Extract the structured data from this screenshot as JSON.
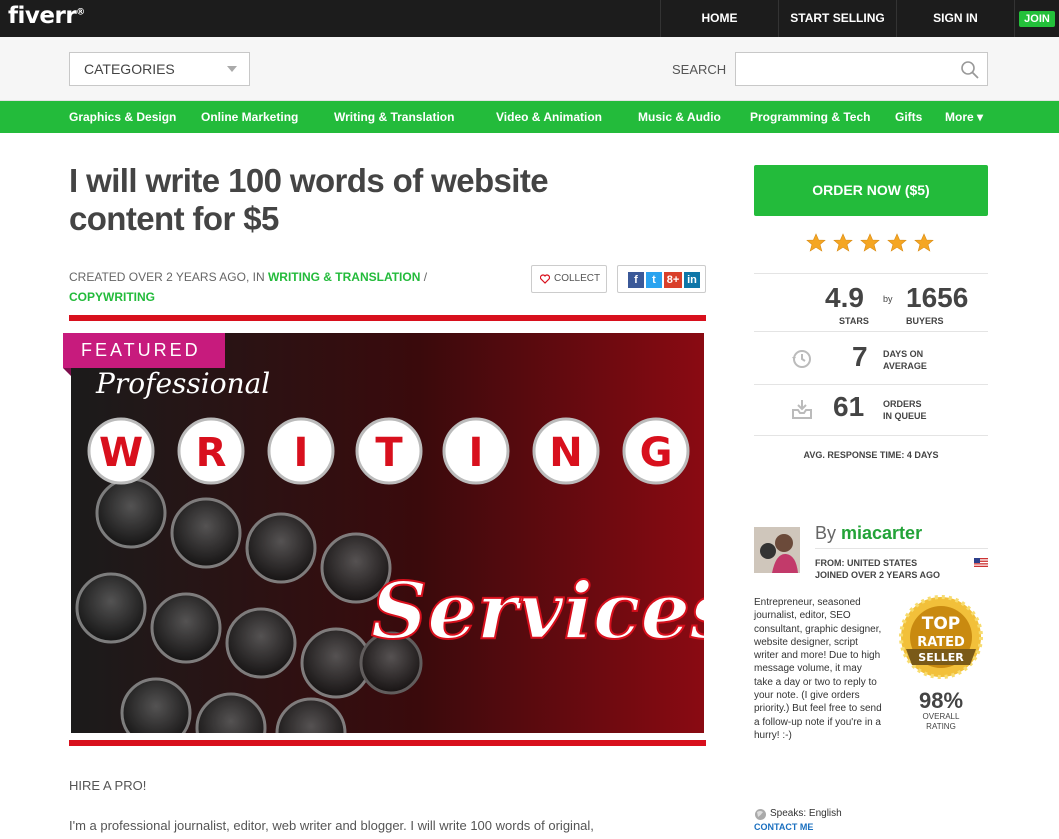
{
  "brand": {
    "logo": "fiverr",
    "mark": "®"
  },
  "topnav": {
    "home": "HOME",
    "start_selling": "START SELLING",
    "sign_in": "SIGN IN",
    "join": "JOIN"
  },
  "search": {
    "categories_label": "CATEGORIES",
    "label": "SEARCH",
    "placeholder": ""
  },
  "categories": [
    "Graphics & Design",
    "Online Marketing",
    "Writing & Translation",
    "Video & Animation",
    "Music & Audio",
    "Programming & Tech",
    "Gifts",
    "More ▾"
  ],
  "gig": {
    "title": "I will write 100 words of website content for $5",
    "created_prefix": "CREATED OVER 2 YEARS AGO, IN ",
    "category": "WRITING & TRANSLATION",
    "separator": " / ",
    "subcategory": "COPYWRITING",
    "collect": "COLLECT",
    "featured": "FEATURED",
    "hero_script_top": "Professional",
    "hero_letters": [
      "W",
      "R",
      "I",
      "T",
      "I",
      "N",
      "G"
    ],
    "hero_script_bottom": "Services"
  },
  "social": {
    "facebook": "f",
    "twitter": "t",
    "gplus": "8+",
    "linkedin": "in"
  },
  "sidebar": {
    "order_button": "ORDER NOW ($5)",
    "rating": "4.9",
    "stars_label": "STARS",
    "by": "by",
    "buyers": "1656",
    "buyers_label": "BUYERS",
    "days": "7",
    "days_label_1": "DAYS ON",
    "days_label_2": "AVERAGE",
    "orders": "61",
    "orders_label_1": "ORDERS",
    "orders_label_2": "IN QUEUE",
    "response": "AVG. RESPONSE TIME: 4 DAYS"
  },
  "seller": {
    "by_prefix": "By ",
    "username": "miacarter",
    "from": "FROM: UNITED STATES",
    "joined": "JOINED OVER 2 YEARS AGO",
    "bio": "Entrepreneur, seasoned journalist, editor, SEO consultant, graphic designer, website designer, script writer and more! Due to high message volume, it may take a day or two to reply to your note. (I give orders priority.) But feel free to send a follow-up note if you're in a hurry! :-)",
    "badge_top": "TOP",
    "badge_rated": "RATED",
    "badge_seller": "SELLER",
    "percent": "98%",
    "overall_1": "OVERALL",
    "overall_2": "RATING",
    "speaks": "Speaks: English",
    "contact": "CONTACT ME"
  },
  "description": {
    "heading": "HIRE A PRO!",
    "text": "I'm a professional journalist, editor, web writer and blogger. I will write 100 words of original,"
  },
  "colors": {
    "green": "#23bb3b",
    "red": "#d8101d",
    "pink": "#c71b7d",
    "dark": "#1c1c1c",
    "star": "#f5a623"
  }
}
